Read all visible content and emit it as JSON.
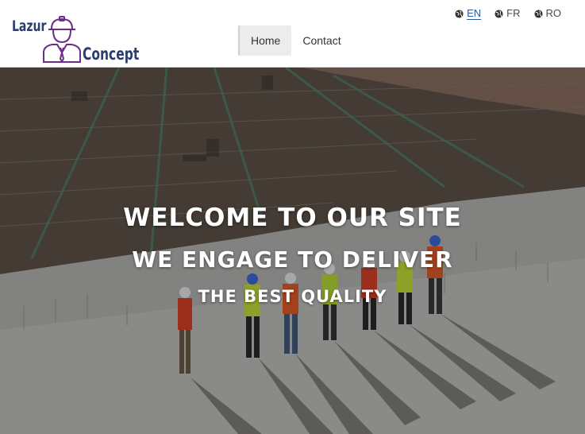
{
  "logo": {
    "line1": "Lazur",
    "line2": "Concept",
    "icon": "worker-helmet-icon",
    "color": "#2c3e6e",
    "accent": "#6b2d86"
  },
  "nav": {
    "items": [
      {
        "label": "Home",
        "active": true
      },
      {
        "label": "Contact",
        "active": false
      }
    ]
  },
  "languages": [
    {
      "code": "EN",
      "icon": "globe-icon",
      "active": true
    },
    {
      "code": "FR",
      "icon": "globe-icon",
      "active": false
    },
    {
      "code": "RO",
      "icon": "globe-icon",
      "active": false
    }
  ],
  "hero": {
    "line1": "WELCOME TO OUR SITE",
    "line2": "WE ENGAGE TO DELIVER",
    "line3": "THE BEST QUALITY",
    "background": "construction-site-photo"
  }
}
